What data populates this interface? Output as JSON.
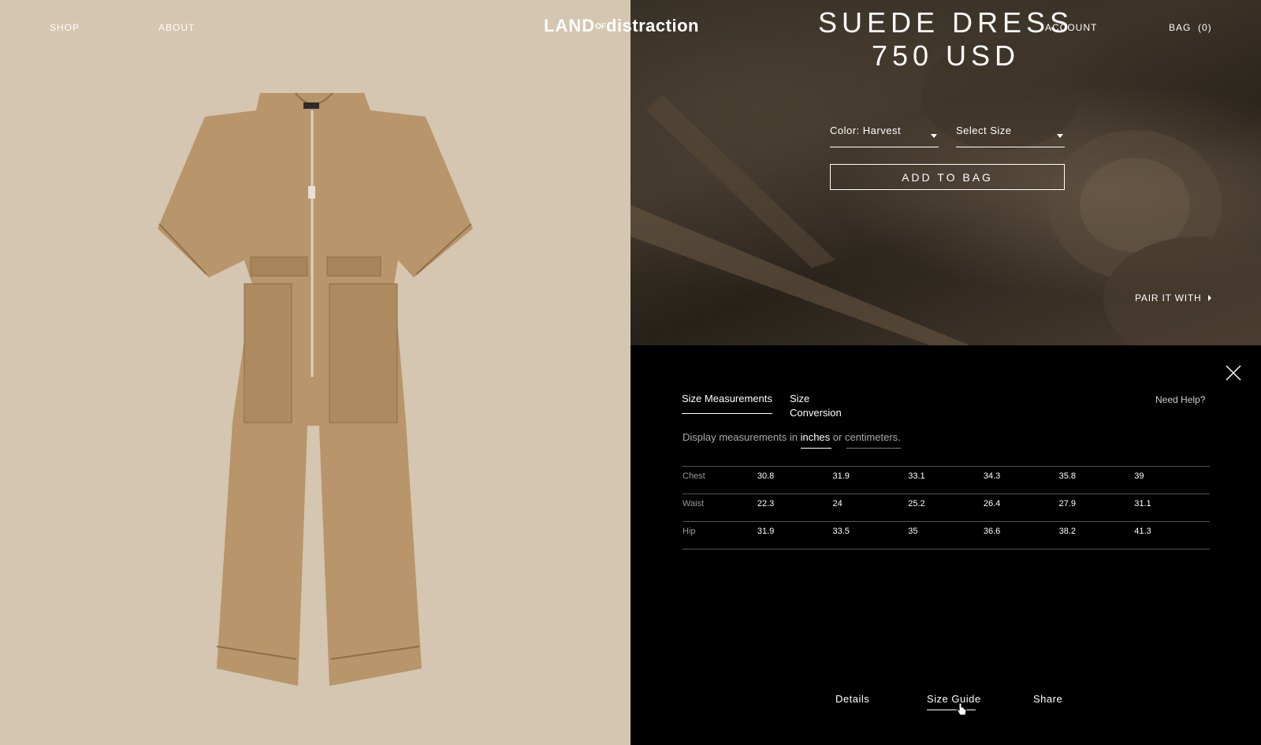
{
  "nav": {
    "shop": "SHOP",
    "about": "ABOUT",
    "logo_land": "LAND",
    "logo_of": "OF",
    "logo_distraction": "distraction",
    "account": "ACCOUNT",
    "bag": "BAG",
    "bag_count": "(0)"
  },
  "product": {
    "name": "SUEDE DRESS",
    "price": "750 USD",
    "color_select": "Color: Harvest",
    "size_select": "Select Size",
    "add_to_bag": "ADD TO BAG",
    "pair_it_with": "PAIR IT WITH"
  },
  "size_guide": {
    "tab_measurements": "Size Measurements",
    "tab_conversion_line1": "Size",
    "tab_conversion_line2": "Conversion",
    "need_help": "Need Help?",
    "display_prefix": "Display measurements in",
    "unit_inches": "inches",
    "display_or": "or",
    "unit_cm": "centimeters.",
    "rows": [
      {
        "label": "Chest",
        "values": [
          "30.8",
          "31.9",
          "33.1",
          "34.3",
          "35.8",
          "39"
        ]
      },
      {
        "label": "Waist",
        "values": [
          "22.3",
          "24",
          "25.2",
          "26.4",
          "27.9",
          "31.1"
        ]
      },
      {
        "label": "Hip",
        "values": [
          "31.9",
          "33.5",
          "35",
          "36.6",
          "38.2",
          "41.3"
        ]
      }
    ]
  },
  "bottom_tabs": {
    "details": "Details",
    "size_guide": "Size Guide",
    "share": "Share"
  },
  "colors": {
    "left_bg": "#d4c6b0",
    "garment": "#b8956a"
  }
}
